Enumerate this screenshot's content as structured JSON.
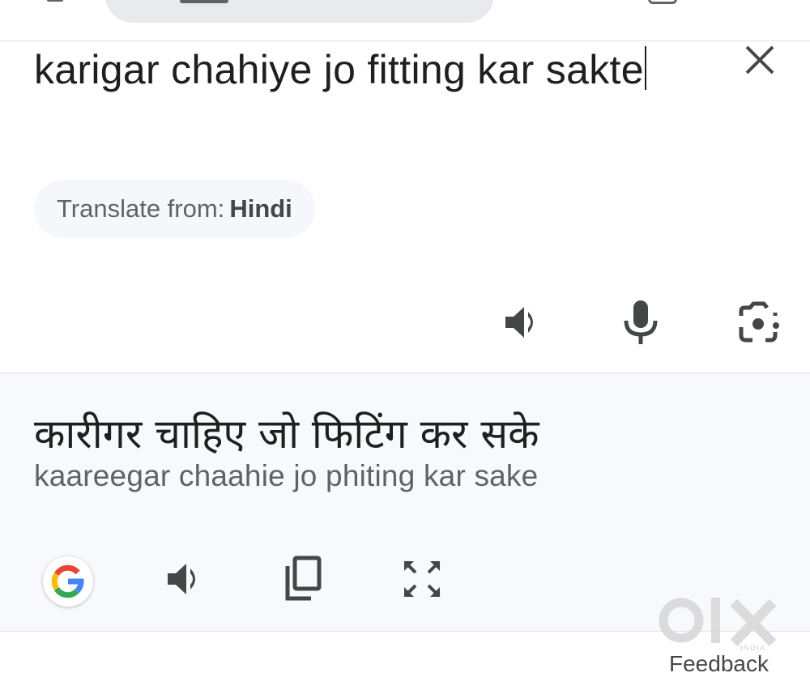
{
  "source": {
    "text": "karigar chahiye jo fitting kar sakte",
    "detected_prefix": "Translate from:",
    "detected_language": "Hindi"
  },
  "result": {
    "translation": "कारीगर चाहिए जो फिटिंग कर सके",
    "transliteration": "kaareegar chaahie jo phiting kar sake"
  },
  "icons": {
    "clear": "close-icon",
    "source_listen": "speaker-icon",
    "voice_input": "microphone-icon",
    "camera_input": "camera-lens-icon",
    "google": "google-g-icon",
    "result_listen": "speaker-icon",
    "copy": "copy-icon",
    "fullscreen": "expand-icon"
  },
  "footer": {
    "feedback_label": "Feedback",
    "watermark_text": "OLX",
    "watermark_sub": "INDIA"
  },
  "colors": {
    "text": "#1f1f1f",
    "secondary_text": "#5f6368",
    "icon": "#444746",
    "result_background": "#f7f9fc",
    "chip_background": "#f5f7fa"
  }
}
